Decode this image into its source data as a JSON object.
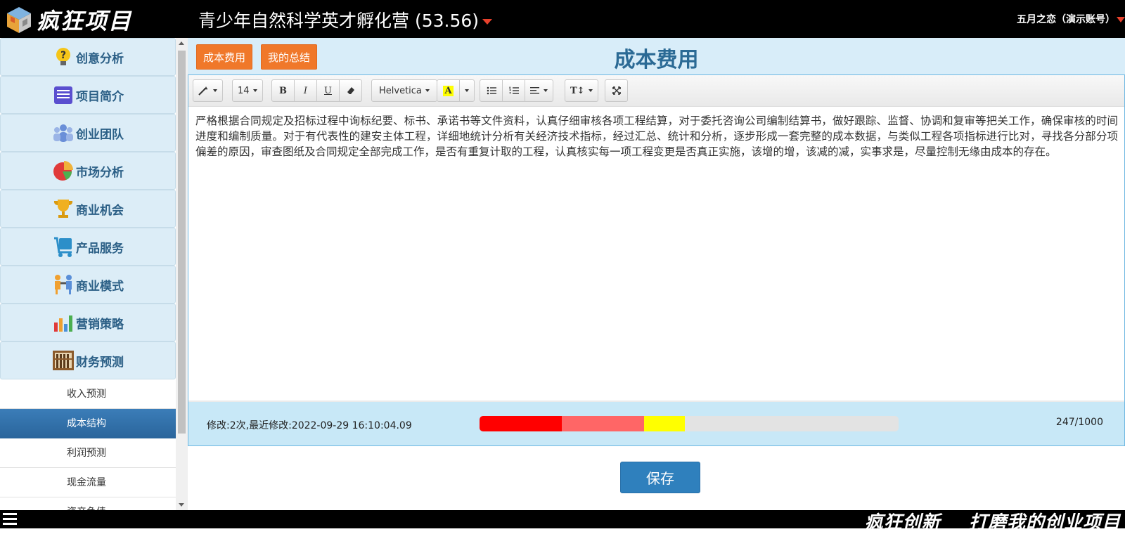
{
  "header": {
    "brand": "疯狂项目",
    "project_title": "青少年自然科学英才孵化营 (53.56)",
    "user": "五月之恋（演示账号）"
  },
  "sidebar": {
    "items": [
      {
        "label": "创意分析",
        "icon": "lightbulb-question-icon"
      },
      {
        "label": "项目简介",
        "icon": "document-icon"
      },
      {
        "label": "创业团队",
        "icon": "team-icon"
      },
      {
        "label": "市场分析",
        "icon": "pie-chart-icon"
      },
      {
        "label": "商业机会",
        "icon": "trophy-icon"
      },
      {
        "label": "产品服务",
        "icon": "cart-icon"
      },
      {
        "label": "商业模式",
        "icon": "handshake-icon"
      },
      {
        "label": "营销策略",
        "icon": "bar-chart-icon"
      },
      {
        "label": "财务预测",
        "icon": "abacus-icon"
      }
    ],
    "sub_items": [
      "收入预测",
      "成本结构",
      "利润预测",
      "现金流量",
      "资产负债"
    ],
    "active_sub_item": "成本结构"
  },
  "main": {
    "tabs": [
      "成本费用",
      "我的总结"
    ],
    "page_title": "成本费用",
    "toolbar": {
      "font_size": "14",
      "font_family": "Helvetica",
      "bold": "B",
      "italic": "I",
      "underline": "U",
      "color_letter": "A",
      "text_style": "T↕"
    },
    "content": "严格根据合同规定及招标过程中询标纪要、标书、承诺书等文件资料，认真仔细审核各项工程结算，对于委托咨询公司编制结算书，做好跟踪、监督、协调和复审等把关工作，确保审核的时间进度和编制质量。对于有代表性的建安主体工程，详细地统计分析有关经济技术指标，经过汇总、统计和分析，逐步形成一套完整的成本数据，与类似工程各项指标进行比对，寻找各分部分项偏差的原因，审查图纸及合同规定全部完成工作，是否有重复计取的工程，认真核实每一项工程变更是否真正实施，该增的增，该减的减，实事求是，尽量控制无缘由成本的存在。",
    "modify_info": "修改:2次,最近修改:2022-09-29 16:10:04.09",
    "char_count": "247/1000",
    "progress_fraction": 0.247,
    "progress_colors": [
      "#ff0000",
      "#ff6666",
      "#ffff00"
    ],
    "save_label": "保存"
  },
  "footer": {
    "slogan": "疯狂创新    打磨我的创业项目"
  }
}
